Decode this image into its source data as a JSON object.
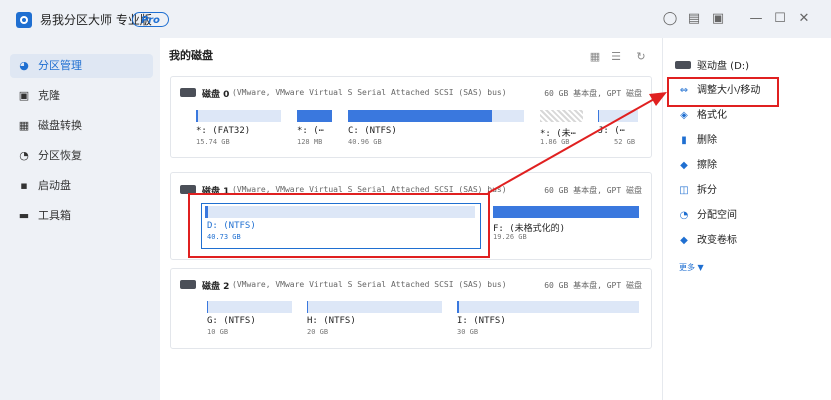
{
  "app": {
    "title": "易我分区大师 专业版",
    "pro_badge": "Pro"
  },
  "window_icons": [
    "bell-icon",
    "note-icon",
    "dropdown-icon",
    "minimize-icon",
    "maximize-icon",
    "close-icon"
  ],
  "sidebar": {
    "items": [
      {
        "label": "分区管理",
        "icon": "pie-icon",
        "active": true
      },
      {
        "label": "克隆",
        "icon": "clone-icon",
        "active": false
      },
      {
        "label": "磁盘转换",
        "icon": "convert-icon",
        "active": false
      },
      {
        "label": "分区恢复",
        "icon": "recover-icon",
        "active": false
      },
      {
        "label": "启动盘",
        "icon": "boot-icon",
        "active": false
      },
      {
        "label": "工具箱",
        "icon": "toolbox-icon",
        "active": false
      }
    ]
  },
  "main": {
    "title": "我的磁盘",
    "disks": [
      {
        "name": "磁盘 0",
        "desc": "(VMware,  VMware Virtual S Serial Attached SCSI (SAS) bus)",
        "info": "60 GB 基本盘, GPT 磁盘",
        "partitions": [
          {
            "label": "*: (FAT32)",
            "size": "15.74 GB",
            "fill": 0.02
          },
          {
            "label": "*: (⋯",
            "size": "128 MB",
            "fill": 1.0
          },
          {
            "label": "C: (NTFS)",
            "size": "40.96 GB",
            "fill": 0.82
          },
          {
            "label": "*: (未⋯",
            "size": "1.86 GB",
            "fill": 0.0
          },
          {
            "label": "J: (⋯",
            "size": "52 GB",
            "fill": 0.02
          }
        ]
      },
      {
        "name": "磁盘 1",
        "desc": "(VMware,  VMware Virtual S Serial Attached SCSI (SAS) bus)",
        "info": "60 GB 基本盘, GPT 磁盘",
        "partitions": [
          {
            "label": "D: (NTFS)",
            "size": "40.73 GB",
            "fill": 0.01
          },
          {
            "label": "F: (未格式化的)",
            "size": "19.26 GB",
            "fill": 1.0
          }
        ]
      },
      {
        "name": "磁盘 2",
        "desc": "(VMware,  VMware Virtual S Serial Attached SCSI (SAS) bus)",
        "info": "60 GB 基本盘, GPT 磁盘",
        "partitions": [
          {
            "label": "G: (NTFS)",
            "size": "10 GB",
            "fill": 0.01
          },
          {
            "label": "H: (NTFS)",
            "size": "20 GB",
            "fill": 0.01
          },
          {
            "label": "I: (NTFS)",
            "size": "30 GB",
            "fill": 0.01
          }
        ]
      }
    ]
  },
  "rightpanel": {
    "drive": "驱动盘 (D:)",
    "ops": [
      {
        "label": "调整大小/移动",
        "icon": "resize-icon",
        "highlighted": true
      },
      {
        "label": "格式化",
        "icon": "format-icon"
      },
      {
        "label": "删除",
        "icon": "trash-icon"
      },
      {
        "label": "擦除",
        "icon": "eraser-icon"
      },
      {
        "label": "拆分",
        "icon": "split-icon"
      },
      {
        "label": "分配空间",
        "icon": "allocate-icon"
      },
      {
        "label": "改变卷标",
        "icon": "tag-icon"
      }
    ],
    "more": "更多 ▼"
  },
  "colors": {
    "accent": "#1f6fd1",
    "bar_fill": "#3a78de",
    "bar_bg": "#dde7f7",
    "highlight": "#e02020"
  }
}
